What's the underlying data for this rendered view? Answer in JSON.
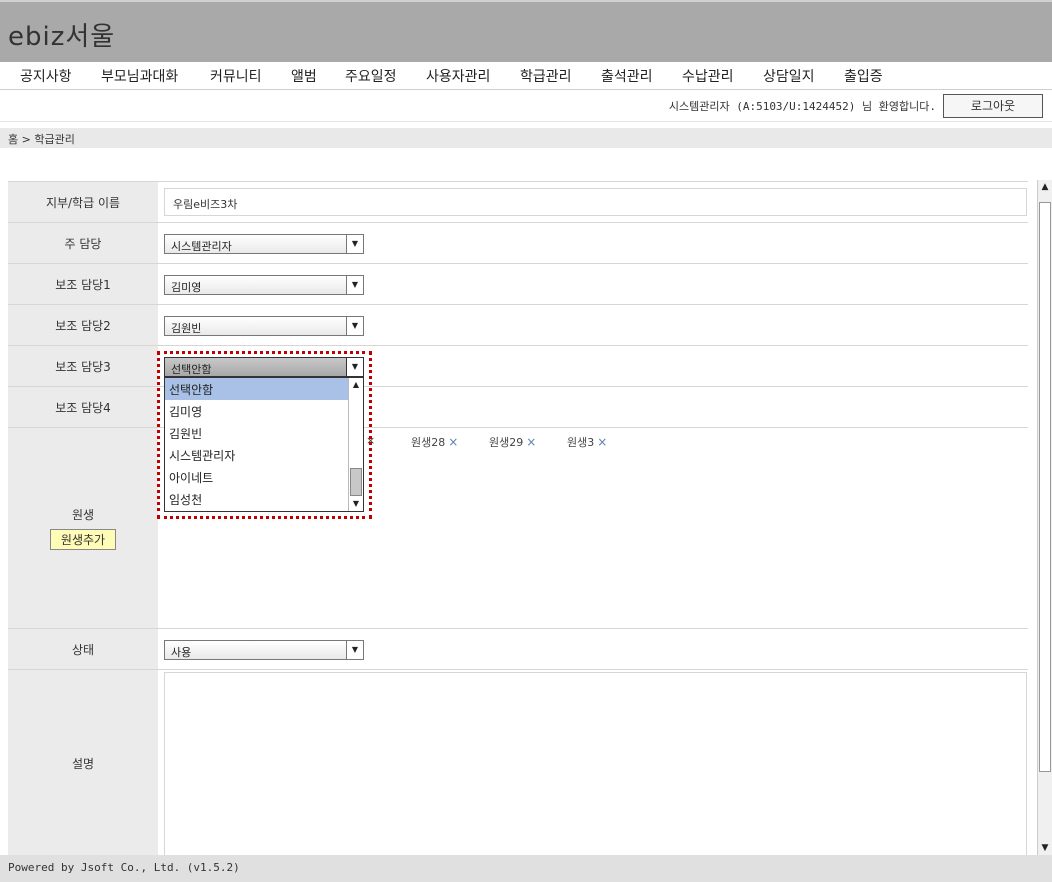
{
  "app": {
    "logo": "ebiz서울"
  },
  "nav": {
    "items": [
      "공지사항",
      "부모님과대화",
      "커뮤니티",
      "앨범",
      "주요일정",
      "사용자관리",
      "학급관리",
      "출석관리",
      "수납관리",
      "상담일지",
      "출입증"
    ]
  },
  "userbar": {
    "welcome": "시스템관리자 (A:5103/U:1424452) 님 환영합니다.",
    "logout_label": "로그아웃"
  },
  "breadcrumb": "홈 > 학급관리",
  "form": {
    "name": {
      "label": "지부/학급 이름",
      "value": "우림e비즈3차"
    },
    "main_manager": {
      "label": "주 담당",
      "value": "시스템관리자"
    },
    "assist1": {
      "label": "보조 담당1",
      "value": "김미영"
    },
    "assist2": {
      "label": "보조 담당2",
      "value": "김원빈"
    },
    "assist3": {
      "label": "보조 담당3",
      "value": "선택안함"
    },
    "assist4": {
      "label": "보조 담당4"
    },
    "students": {
      "label": "원생",
      "add_label": "원생추가",
      "chips": [
        "원생28",
        "원생29",
        "원생3"
      ],
      "remove_glyph": "×"
    },
    "status": {
      "label": "상태",
      "value": "사용"
    },
    "description": {
      "label": "설명",
      "value": ""
    }
  },
  "dropdown": {
    "selected": "선택안함",
    "options": [
      "선택안함",
      "김미영",
      "김원빈",
      "시스템관리자",
      "아이네트",
      "임성천"
    ]
  },
  "footer": "Powered by Jsoft Co., Ltd. (v1.5.2)"
}
